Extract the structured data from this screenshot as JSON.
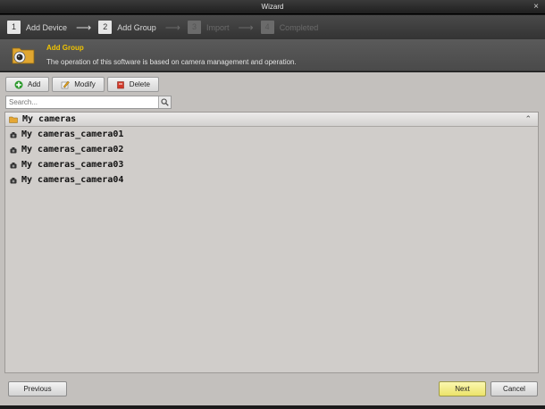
{
  "window": {
    "title": "Wizard",
    "close": "×"
  },
  "steps": [
    {
      "num": "1",
      "label": "Add Device",
      "active": true
    },
    {
      "num": "2",
      "label": "Add Group",
      "active": true
    },
    {
      "num": "3",
      "label": "Import",
      "active": false
    },
    {
      "num": "4",
      "label": "Completed",
      "active": false
    }
  ],
  "info": {
    "title": "Add Group",
    "description": "The operation of this software is based on camera management and operation."
  },
  "toolbar": {
    "add_label": "Add",
    "modify_label": "Modify",
    "delete_label": "Delete"
  },
  "search": {
    "placeholder": "Search..."
  },
  "tree": {
    "group_name": "My cameras",
    "cameras": [
      "My cameras_camera01",
      "My cameras_camera02",
      "My cameras_camera03",
      "My cameras_camera04"
    ]
  },
  "footer": {
    "previous_label": "Previous",
    "next_label": "Next",
    "cancel_label": "Cancel"
  },
  "colors": {
    "accent_yellow": "#f1c400",
    "next_button": "#ece36a",
    "panel_bg": "#c3c0bd"
  }
}
